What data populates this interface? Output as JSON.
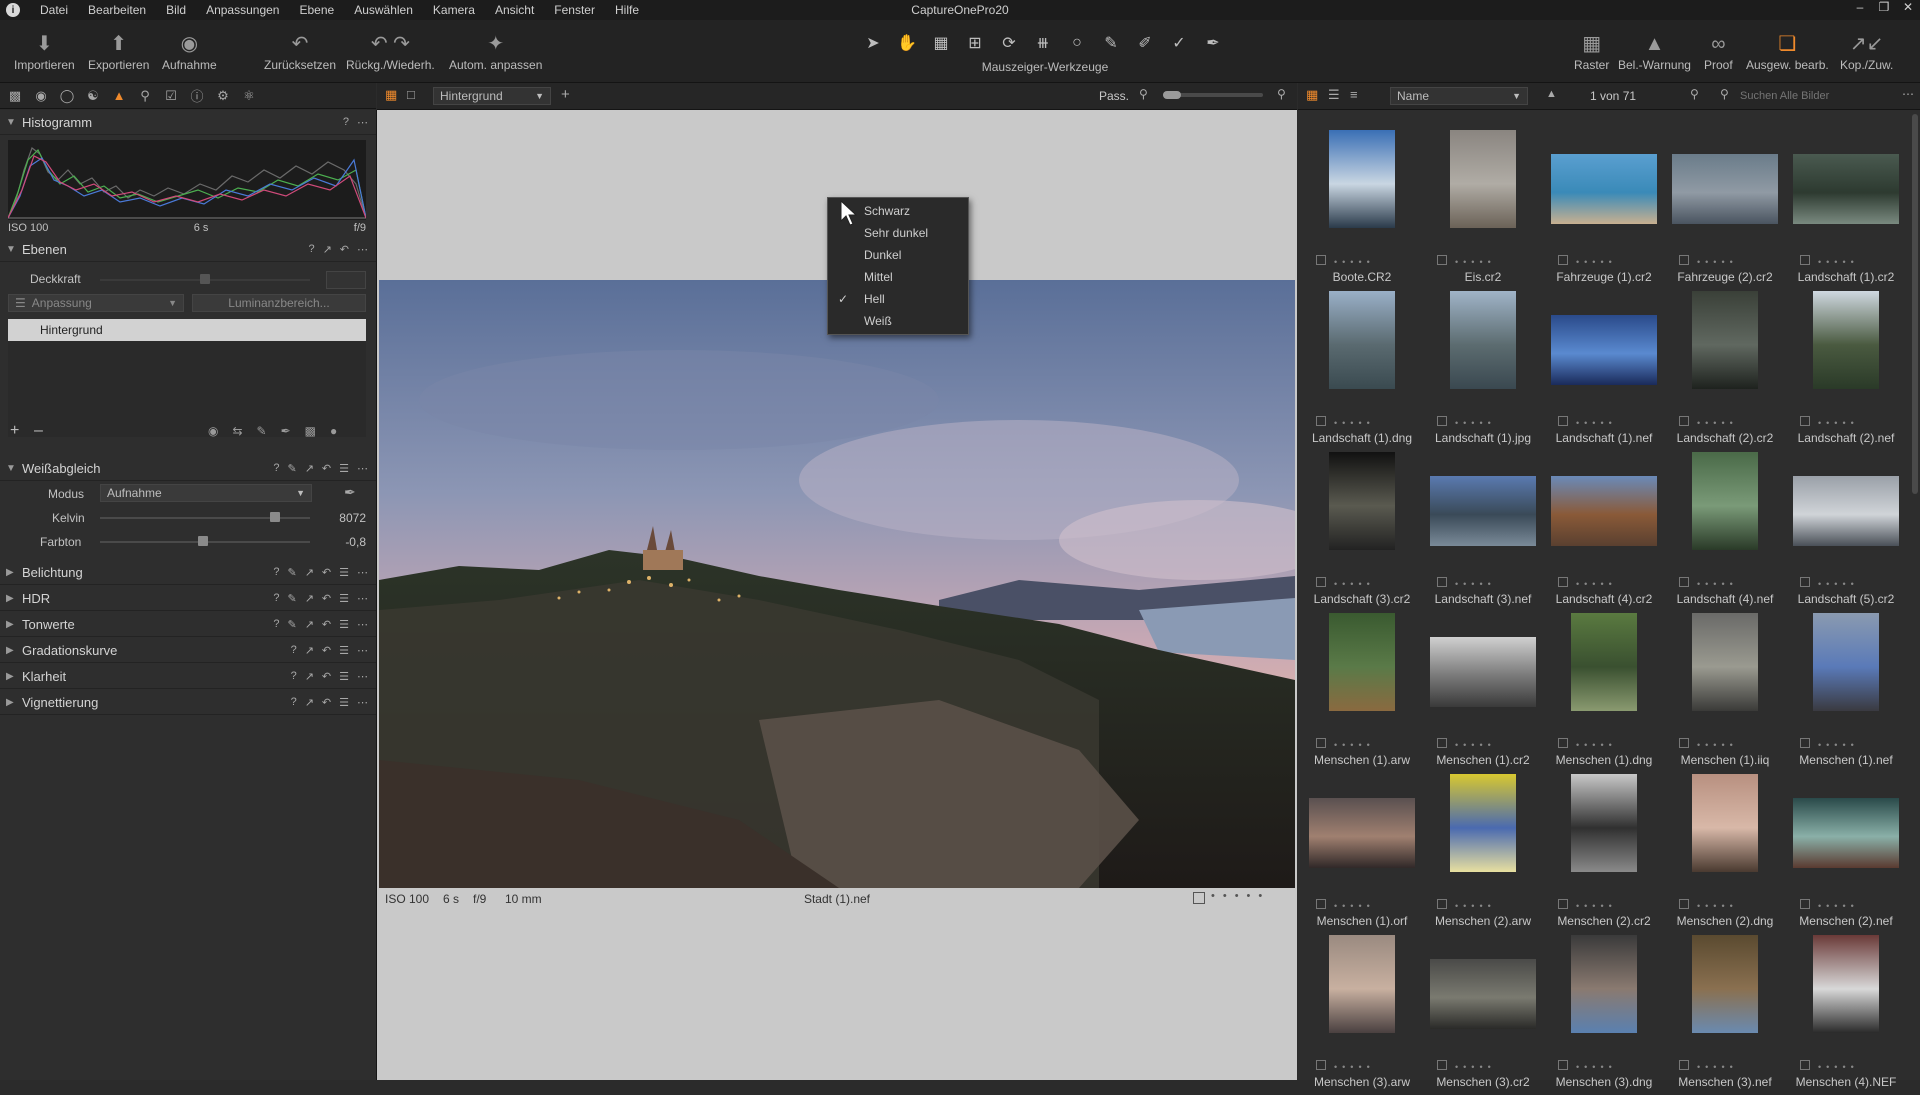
{
  "app": {
    "title": "CaptureOnePro20",
    "menu": [
      "Datei",
      "Bearbeiten",
      "Bild",
      "Anpassungen",
      "Ebene",
      "Auswählen",
      "Kamera",
      "Ansicht",
      "Fenster",
      "Hilfe"
    ]
  },
  "toolbar": {
    "left_buttons": [
      {
        "label": "Importieren",
        "icon": "import-icon"
      },
      {
        "label": "Exportieren",
        "icon": "export-icon"
      },
      {
        "label": "Aufnahme",
        "icon": "camera-icon"
      },
      {
        "label": "Zurücksetzen",
        "icon": "reset-icon"
      },
      {
        "label": "Rückg./Wiederh.",
        "icon": "undo-redo-icon"
      },
      {
        "label": "Autom. anpassen",
        "icon": "magic-wand-icon"
      }
    ],
    "cursor_tools_label": "Mauszeiger-Werkzeuge",
    "right_buttons": [
      {
        "label": "Raster",
        "icon": "grid-icon"
      },
      {
        "label": "Bel.-Warnung",
        "icon": "warning-icon"
      },
      {
        "label": "Proof",
        "icon": "glasses-icon"
      },
      {
        "label": "Ausgew. bearb.",
        "icon": "edit-selected-icon"
      },
      {
        "label": "Kop./Zuw.",
        "icon": "copy-apply-icon"
      }
    ]
  },
  "left_panel": {
    "histogram": {
      "title": "Histogramm",
      "iso": "ISO 100",
      "shutter": "6 s",
      "aperture": "f/9"
    },
    "layers": {
      "title": "Ebenen",
      "opacity_label": "Deckkraft",
      "adjust_label": "Anpassung",
      "luminance_label": "Luminanzbereich...",
      "layer_name": "Hintergrund"
    },
    "white_balance": {
      "title": "Weißabgleich",
      "mode_label": "Modus",
      "mode_value": "Aufnahme",
      "kelvin_label": "Kelvin",
      "kelvin_value": "8072",
      "tint_label": "Farbton",
      "tint_value": "-0,8"
    },
    "sections": [
      "Belichtung",
      "HDR",
      "Tonwerte",
      "Gradationskurve",
      "Klarheit",
      "Vignettierung"
    ]
  },
  "viewer": {
    "layer_dropdown": "Hintergrund",
    "fit_label": "Pass.",
    "status": {
      "iso": "ISO 100",
      "shutter": "6 s",
      "aperture": "f/9",
      "focal": "10 mm",
      "filename": "Stadt (1).nef"
    }
  },
  "context_menu": {
    "items": [
      "Schwarz",
      "Sehr dunkel",
      "Dunkel",
      "Mittel",
      "Hell",
      "Weiß"
    ],
    "checked": "Hell"
  },
  "browser": {
    "sort_value": "Name",
    "count": "1 von 71",
    "search_placeholder": "Suchen Alle Bilder",
    "thumbnails": [
      {
        "name": "Boote.CR2",
        "colors": [
          "#3a6fb5",
          "#c9d6e2",
          "#2a3a4a"
        ],
        "shape": "portrait"
      },
      {
        "name": "Eis.cr2",
        "colors": [
          "#8a8580",
          "#b0aca5",
          "#6b6257"
        ],
        "shape": "portrait"
      },
      {
        "name": "Fahrzeuge (1).cr2",
        "colors": [
          "#5a9fd0",
          "#3a8ab8",
          "#c8b090"
        ],
        "shape": "landscape"
      },
      {
        "name": "Fahrzeuge (2).cr2",
        "colors": [
          "#6a7c8a",
          "#909aa4",
          "#4a5460"
        ],
        "shape": "landscape"
      },
      {
        "name": "Landschaft (1).cr2",
        "colors": [
          "#4a5a50",
          "#2d3a30",
          "#7a8a80"
        ],
        "shape": "landscape"
      },
      {
        "name": "Landschaft (1).dng",
        "colors": [
          "#9ab0c8",
          "#5a6a70",
          "#3a4a50"
        ],
        "shape": "portrait"
      },
      {
        "name": "Landschaft (1).jpg",
        "colors": [
          "#a0b4c8",
          "#5c6c70",
          "#3a4850"
        ],
        "shape": "portrait"
      },
      {
        "name": "Landschaft (1).nef",
        "colors": [
          "#2a4a8a",
          "#5a8ad0",
          "#1a2a5a"
        ],
        "shape": "landscape"
      },
      {
        "name": "Landschaft (2).cr2",
        "colors": [
          "#3a4038",
          "#606860",
          "#1e221e"
        ],
        "shape": "portrait"
      },
      {
        "name": "Landschaft (2).nef",
        "colors": [
          "#cfd8e0",
          "#4a5a40",
          "#2a3a28"
        ],
        "shape": "portrait"
      },
      {
        "name": "Landschaft (3).cr2",
        "colors": [
          "#111111",
          "#5a5a50",
          "#222222"
        ],
        "shape": "portrait"
      },
      {
        "name": "Landschaft (3).nef",
        "colors": [
          "#5a7ab0",
          "#3a4a58",
          "#7a8a98"
        ],
        "shape": "landscape"
      },
      {
        "name": "Landschaft (4).cr2",
        "colors": [
          "#6a8ab8",
          "#8a5a38",
          "#5a4030"
        ],
        "shape": "landscape"
      },
      {
        "name": "Landschaft (4).nef",
        "colors": [
          "#4a6a48",
          "#7a9a78",
          "#2a3a28"
        ],
        "shape": "portrait"
      },
      {
        "name": "Landschaft (5).cr2",
        "colors": [
          "#9aa0a8",
          "#d0d4d8",
          "#4a5058"
        ],
        "shape": "landscape"
      },
      {
        "name": "Menschen (1).arw",
        "colors": [
          "#3a5a30",
          "#5a7a48",
          "#8a6a40"
        ],
        "shape": "portrait"
      },
      {
        "name": "Menschen (1).cr2",
        "colors": [
          "#d0d0d0",
          "#7a7a7a",
          "#3a3a3a"
        ],
        "shape": "landscape"
      },
      {
        "name": "Menschen (1).dng",
        "colors": [
          "#5a7a40",
          "#3a5030",
          "#8a9a70"
        ],
        "shape": "portrait"
      },
      {
        "name": "Menschen (1).iiq",
        "colors": [
          "#6a6a68",
          "#9a9a90",
          "#3a3a38"
        ],
        "shape": "portrait"
      },
      {
        "name": "Menschen (1).nef",
        "colors": [
          "#8a9ab0",
          "#5a7ab8",
          "#3a3a40"
        ],
        "shape": "portrait"
      },
      {
        "name": "Menschen (1).orf",
        "colors": [
          "#5a5050",
          "#a08070",
          "#302828"
        ],
        "shape": "landscape"
      },
      {
        "name": "Menschen (2).arw",
        "colors": [
          "#d8c830",
          "#4a6ab0",
          "#e8e0a0"
        ],
        "shape": "portrait"
      },
      {
        "name": "Menschen (2).cr2",
        "colors": [
          "#c8c8c8",
          "#303030",
          "#8a8a8a"
        ],
        "shape": "portrait"
      },
      {
        "name": "Menschen (2).dng",
        "colors": [
          "#b89080",
          "#d8b8a8",
          "#4a3a30"
        ],
        "shape": "portrait"
      },
      {
        "name": "Menschen (2).nef",
        "colors": [
          "#2a4a4a",
          "#8ab0a8",
          "#5a3a30"
        ],
        "shape": "landscape"
      },
      {
        "name": "Menschen (3).arw",
        "colors": [
          "#9a8a80",
          "#c8b0a0",
          "#4a4040"
        ],
        "shape": "portrait"
      },
      {
        "name": "Menschen (3).cr2",
        "colors": [
          "#4a4a48",
          "#7a7a70",
          "#2a2a28"
        ],
        "shape": "landscape"
      },
      {
        "name": "Menschen (3).dng",
        "colors": [
          "#3a3a3a",
          "#8a7a70",
          "#5a80b0"
        ],
        "shape": "portrait"
      },
      {
        "name": "Menschen (3).nef",
        "colors": [
          "#5a4a30",
          "#8a7050",
          "#6a8ab0"
        ],
        "shape": "portrait"
      },
      {
        "name": "Menschen (4).NEF",
        "colors": [
          "#6a3a38",
          "#d8d8d8",
          "#2a2a2a"
        ],
        "shape": "portrait"
      }
    ]
  },
  "colors": {
    "accent": "#ef8a2c",
    "panel_bg": "#2e2e2e",
    "viewer_bg": "#c9c9c9"
  }
}
